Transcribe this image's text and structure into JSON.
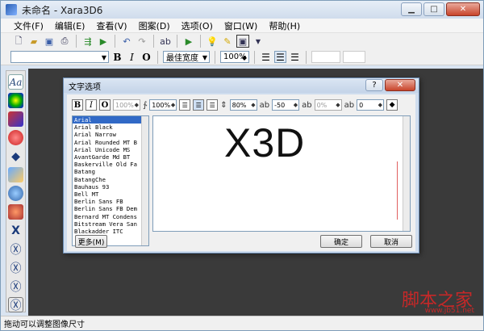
{
  "window": {
    "title": "未命名 - Xara3D6"
  },
  "menu": [
    "文件(F)",
    "编辑(E)",
    "查看(V)",
    "图案(D)",
    "选项(O)",
    "窗口(W)",
    "帮助(H)"
  ],
  "toolbar2": {
    "font_combo": "",
    "bold": "B",
    "italic": "I",
    "outline": "O",
    "width_combo": "最佳宽度",
    "zoom": "100%"
  },
  "dialog": {
    "title": "文字选项",
    "help": "?",
    "close": "✕",
    "toolbar": {
      "bold": "B",
      "italic": "I",
      "outline": "O",
      "size1": "100%",
      "size2": "100%",
      "line_spacing": "80%",
      "kerning": "-50",
      "baseline": "0%",
      "tab": "0"
    },
    "fonts": [
      "Arial",
      "Arial Black",
      "Arial Narrow",
      "Arial Rounded MT B",
      "Arial Unicode MS",
      "AvantGarde Md BT",
      "Baskerville Old Fa",
      "Batang",
      "BatangChe",
      "Bauhaus 93",
      "Bell MT",
      "Berlin Sans FB",
      "Berlin Sans FB Dem",
      "Bernard MT Condens",
      "Bitstream Vera San",
      "Blackadder ITC"
    ],
    "selected_font": "Arial",
    "preview_text": "X3D",
    "buttons": {
      "more": "更多(M)",
      "ok": "确定",
      "cancel": "取消"
    }
  },
  "status": "拖动可以调整图像尺寸",
  "watermark": {
    "text": "脚本之家",
    "url": "www.jb51.net"
  }
}
